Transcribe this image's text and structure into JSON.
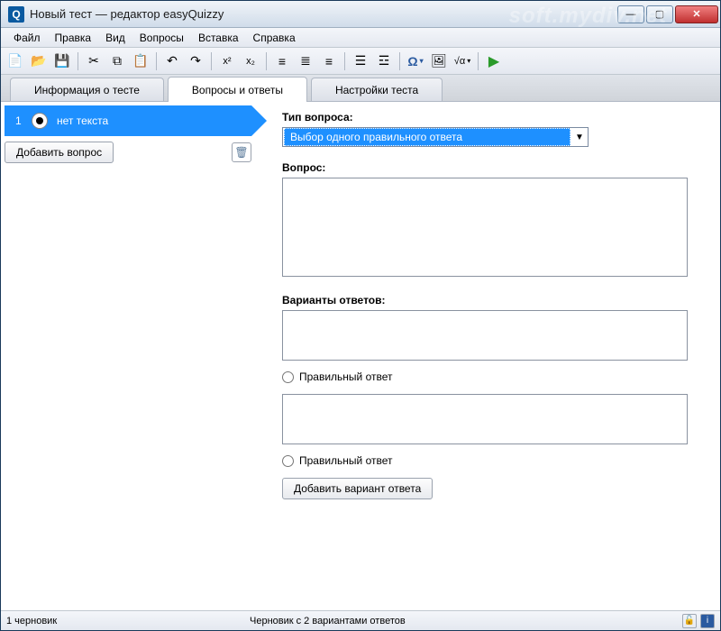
{
  "window": {
    "title": "Новый тест — редактор easyQuizzy",
    "app_letter": "Q"
  },
  "menu": {
    "file": "Файл",
    "edit": "Правка",
    "view": "Вид",
    "questions": "Вопросы",
    "insert": "Вставка",
    "help": "Справка"
  },
  "tabs": {
    "info": "Информация о тесте",
    "qa": "Вопросы и ответы",
    "settings": "Настройки теста"
  },
  "sidebar": {
    "q1_num": "1",
    "q1_text": "нет текста",
    "add_question": "Добавить вопрос"
  },
  "form": {
    "type_label": "Тип вопроса:",
    "type_value": "Выбор одного правильного ответа",
    "question_label": "Вопрос:",
    "question_value": "",
    "answers_label": "Варианты ответов:",
    "answer1_value": "",
    "answer1_correct": "Правильный ответ",
    "answer2_value": "",
    "answer2_correct": "Правильный ответ",
    "add_answer": "Добавить вариант ответа"
  },
  "status": {
    "left": "1 черновик",
    "center": "Черновик с 2 вариантами ответов"
  },
  "watermark": "soft.mydiv.net"
}
